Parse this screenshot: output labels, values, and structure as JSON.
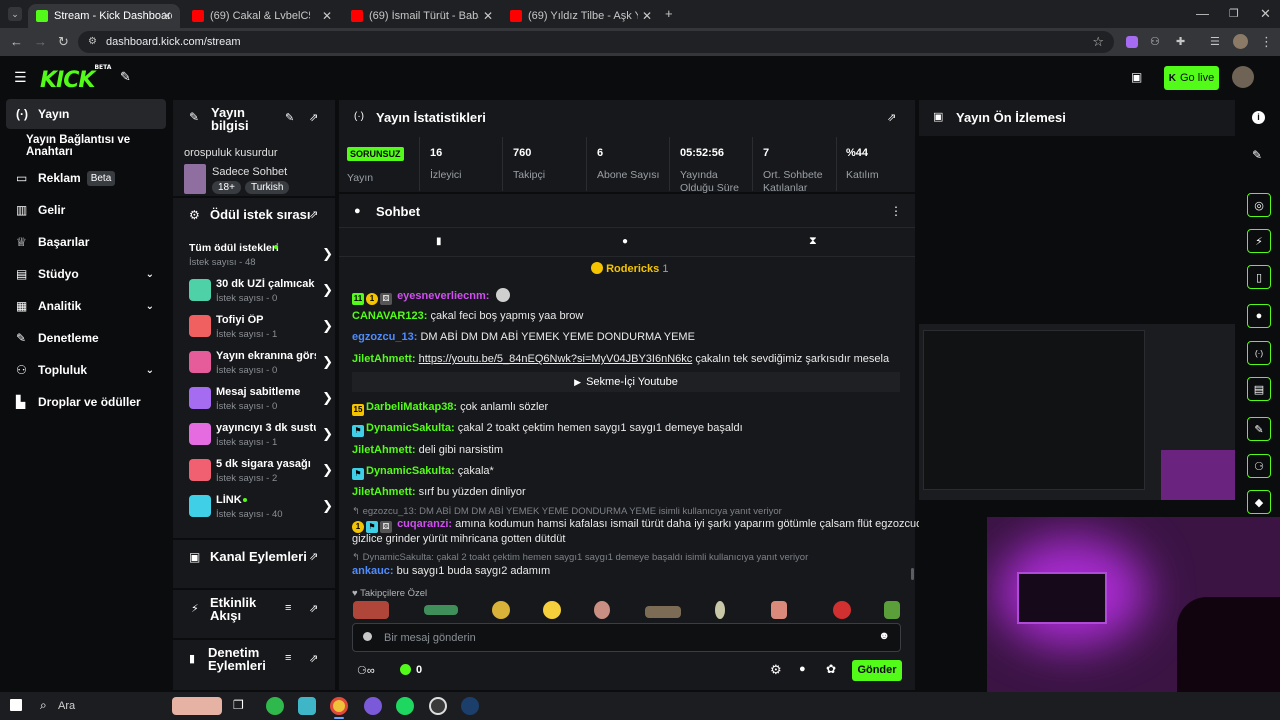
{
  "browser": {
    "tabs": [
      {
        "label": "Stream - Kick Dashboard",
        "color": "#53fc18"
      },
      {
        "label": "(69) Cakal & LvbelC5 – JET",
        "color": "#ff0000"
      },
      {
        "label": "(69) İsmail Türüt - Babasından",
        "color": "#ff0000"
      },
      {
        "label": "(69) Yıldız Tilbe - Aşk Yok Olma",
        "color": "#ff0000"
      }
    ],
    "url": "dashboard.kick.com/stream"
  },
  "header": {
    "logo": "KICK",
    "logo_sup": "BETA",
    "go_live": "Go live"
  },
  "sidebar": {
    "items": [
      {
        "label": "Yayın",
        "icon": "broadcast-icon"
      },
      {
        "label": "Yayın Bağlantısı ve Anahtarı"
      },
      {
        "label": "Reklam",
        "badge": "Beta",
        "icon": "ad-icon"
      },
      {
        "label": "Gelir",
        "icon": "revenue-icon"
      },
      {
        "label": "Başarılar",
        "icon": "trophy-icon"
      },
      {
        "label": "Stüdyo",
        "icon": "studio-icon"
      },
      {
        "label": "Analitik",
        "icon": "analytics-icon"
      },
      {
        "label": "Denetleme",
        "icon": "wrench-icon"
      },
      {
        "label": "Topluluk",
        "icon": "community-icon"
      },
      {
        "label": "Droplar ve ödüller",
        "icon": "drops-icon"
      }
    ]
  },
  "stream_info": {
    "title": "Yayın bilgisi",
    "stream_title": "orospuluk kusurdur",
    "category": "Sadece Sohbet",
    "tags": [
      "18+",
      "Turkish"
    ]
  },
  "rewards": {
    "title": "Ödül istek sırası",
    "all_label": "Tüm ödül istekleri",
    "all_count": "İstek sayısı - 48",
    "items": [
      {
        "title": "30 dk UZİ çalmıcak",
        "count": "İstek sayısı - 0",
        "color": "#4fd1a8"
      },
      {
        "title": "Tofiyi ÖP",
        "count": "İstek sayısı - 1",
        "color": "#f06060"
      },
      {
        "title": "Yayın ekranına görs...",
        "count": "İstek sayısı - 0",
        "color": "#e65c9a"
      },
      {
        "title": "Mesaj sabitleme",
        "count": "İstek sayısı - 0",
        "color": "#a56bf0"
      },
      {
        "title": "yayıncıyı 3 dk sustur",
        "count": "İstek sayısı - 1",
        "color": "#e46be0"
      },
      {
        "title": "5 dk sigara yasağı",
        "count": "İstek sayısı - 2",
        "color": "#f06070"
      },
      {
        "title": "LİNK",
        "count": "İstek sayısı - 40",
        "color": "#3fd0e8"
      }
    ]
  },
  "channel_actions": {
    "title": "Kanal Eylemleri"
  },
  "activity_feed": {
    "title": "Etkinlik Akışı"
  },
  "mod_actions": {
    "title": "Denetim Eylemleri"
  },
  "stats": {
    "title": "Yayın İstatistikleri",
    "items": [
      {
        "value": "SORUNSUZ",
        "label": "Yayın"
      },
      {
        "value": "16",
        "label": "İzleyici"
      },
      {
        "value": "760",
        "label": "Takipçi"
      },
      {
        "value": "6",
        "label": "Abone Sayısı"
      },
      {
        "value": "05:52:56",
        "label": "Yayında Olduğu Süre"
      },
      {
        "value": "7",
        "label": "Ort. Sohbete Katılanlar"
      },
      {
        "value": "%44",
        "label": "Katılım"
      }
    ]
  },
  "preview": {
    "title": "Yayın Ön İzlemesi"
  },
  "chat": {
    "title": "Sohbet",
    "pinned_user": "Rodericks",
    "pinned_count": "1",
    "messages": [
      {
        "user": "eyesneverliecnm:",
        "color": "#d04ef0",
        "text": ""
      },
      {
        "user": "CANAVAR123:",
        "color": "#53fc18",
        "text": "çakal feci boş yapmış yaa brow"
      },
      {
        "user": "egzozcu_13:",
        "color": "#4f8cff",
        "text": "DM ABİ DM DM ABİ YEMEK YEME DONDURMA YEME"
      },
      {
        "user": "JiletAhmett:",
        "color": "#53fc18",
        "link": "https://youtu.be/5_84nEQ6Nwk?si=MyV04JBY3I6nN6kc",
        "text": "çakalın tek sevdiğimiz şarkısıdır mesela"
      },
      {
        "user": "DarbeliMatkap38:",
        "color": "#53fc18",
        "text": "çok anlamlı sözler"
      },
      {
        "user": "DynamicSakulta:",
        "color": "#53fc18",
        "text": "çakal 2 toakt çektim hemen saygı1 saygı1 demeye başaldı"
      },
      {
        "user": "JiletAhmett:",
        "color": "#53fc18",
        "text": "deli gibi narsistim"
      },
      {
        "user": "DynamicSakulta:",
        "color": "#53fc18",
        "text": "çakala*"
      },
      {
        "user": "JiletAhmett:",
        "color": "#53fc18",
        "text": "sırf bu yüzden dinliyor"
      },
      {
        "user": "cuqaranzi:",
        "color": "#d04ef0",
        "text": "amına kodumun hamsi kafalası ismail türüt daha iyi şarkı yaparım götümle çalsam flüt egzozcudan"
      },
      {
        "user": "ankauc:",
        "color": "#4f8cff",
        "text": "bu saygı1 buda saygı2 adamım"
      }
    ],
    "continuation": "gizlice grinder yürüt mihricana gotten dütdüt",
    "youtube_button": "Sekme-İçi Youtube",
    "reply1": "egzozcu_13: DM ABİ DM DM ABİ YEMEK YEME DONDURMA YEME isimli kullanıcıya yanıt veriyor",
    "reply2": "DynamicSakulta: çakal 2 toakt çektim hemen saygı1 saygı1 demeye başaldı isimli kullanıcıya yanıt veriyor",
    "emote_section": "Takipçilere Özel",
    "input_placeholder": "Bir mesaj gönderin",
    "send_label": "Gönder",
    "points": "0"
  },
  "taskbar": {
    "search": "Ara"
  }
}
